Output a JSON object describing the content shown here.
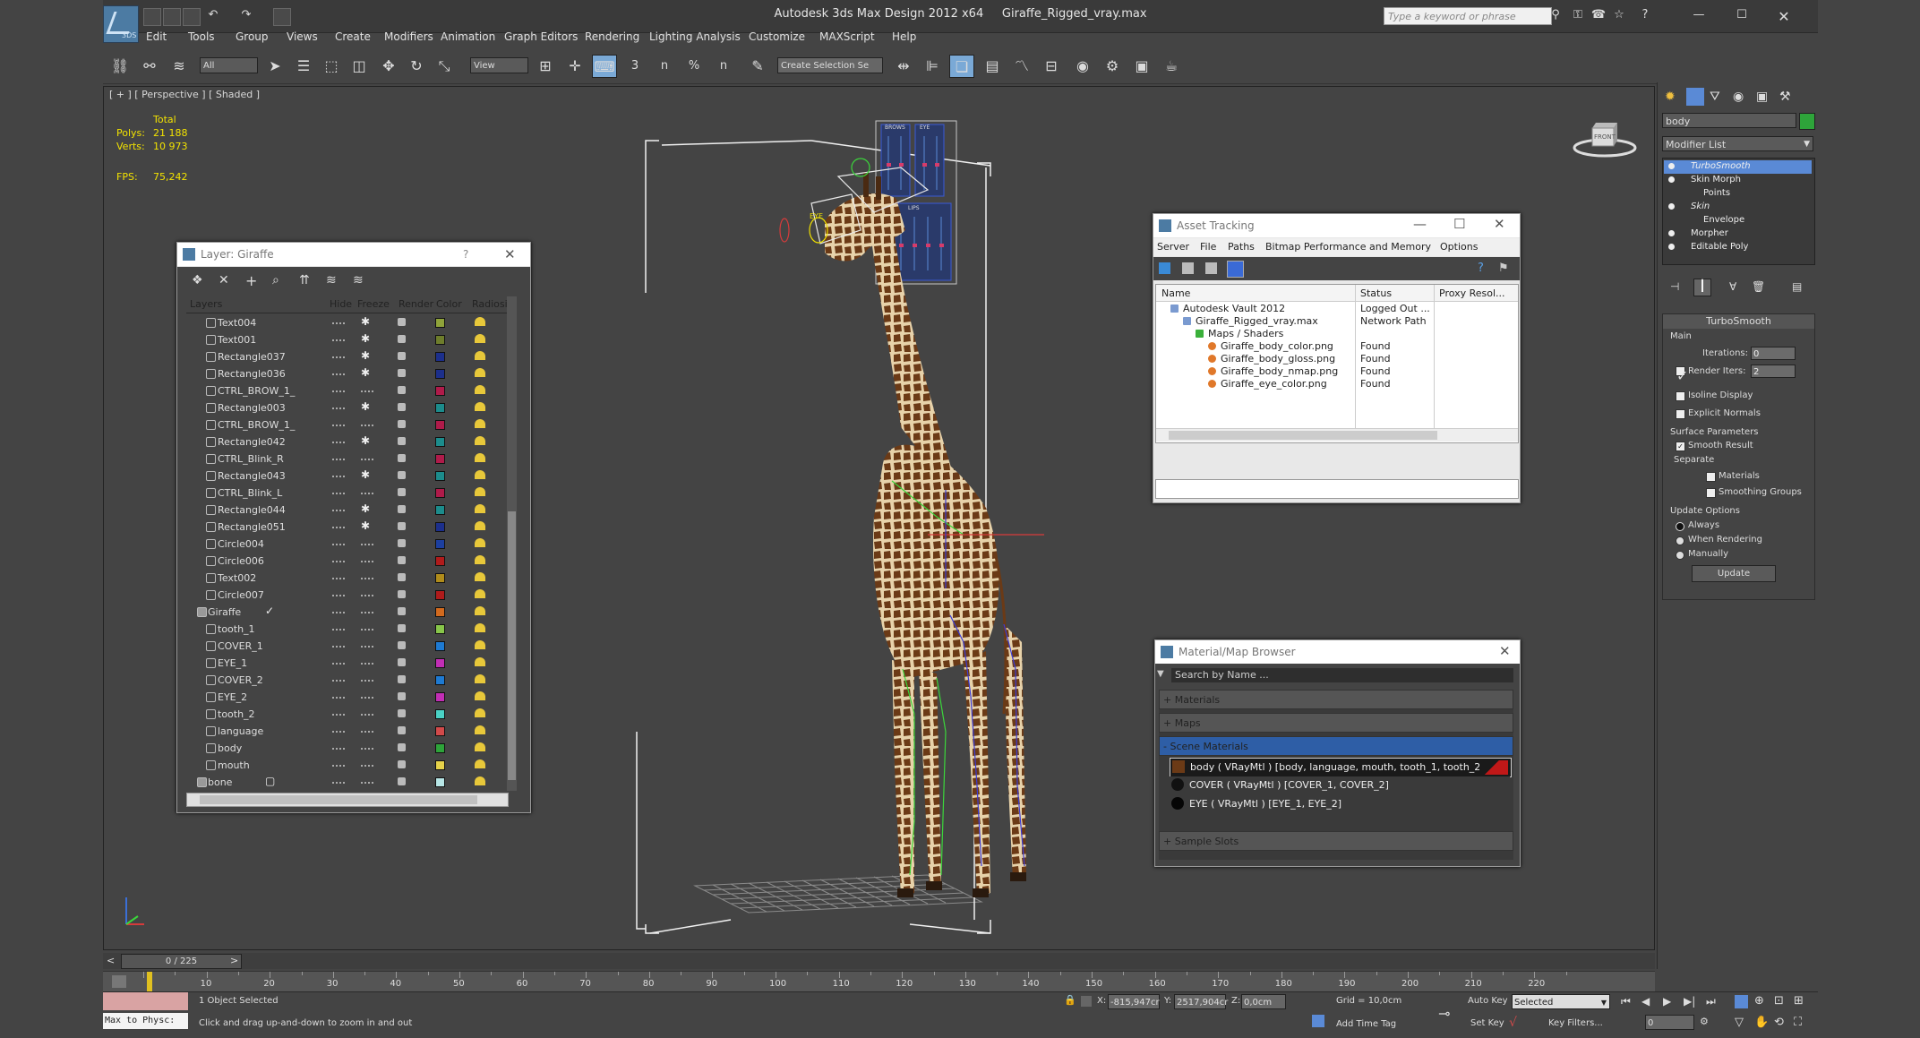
{
  "window": {
    "app_title": "Autodesk 3ds Max Design 2012 x64",
    "file_name": "Giraffe_Rigged_vray.max",
    "search_placeholder": "Type a keyword or phrase",
    "logo_text": "3DS"
  },
  "menu": [
    "Edit",
    "Tools",
    "Group",
    "Views",
    "Create",
    "Modifiers",
    "Animation",
    "Graph Editors",
    "Rendering",
    "Lighting Analysis",
    "Customize",
    "MAXScript",
    "Help"
  ],
  "toolbar": {
    "selection_filter": "All",
    "ref_coord": "View",
    "selection_set": "Create Selection Se",
    "snap_labels": [
      "3",
      "n",
      "%",
      "n"
    ]
  },
  "viewport": {
    "label": "[ + ] [ Perspective ] [ Shaded ]",
    "stats_header": "Total",
    "polys_label": "Polys:",
    "polys_value": "21 188",
    "verts_label": "Verts:",
    "verts_value": "10 973",
    "fps_label": "FPS:",
    "fps_value": "75,242",
    "viewcube_label": "FRONT",
    "rig_labels": {
      "brows": "BROWS",
      "eye": "EYE",
      "lips": "LIPS",
      "eye_ctrl": "EYE"
    }
  },
  "layer_panel": {
    "title": "Layer: Giraffe",
    "help": "?",
    "columns": [
      "Layers",
      "Hide",
      "Freeze",
      "Render",
      "Color",
      "Radiosi"
    ],
    "rows": [
      {
        "name": "Text004",
        "color": "#8fa33a",
        "freeze": true,
        "type": "item"
      },
      {
        "name": "Text001",
        "color": "#6e7d2c",
        "freeze": true,
        "type": "item"
      },
      {
        "name": "Rectangle037",
        "color": "#1c2f8c",
        "freeze": true,
        "type": "item"
      },
      {
        "name": "Rectangle036",
        "color": "#1c2f8c",
        "freeze": true,
        "type": "item"
      },
      {
        "name": "CTRL_BROW_1_",
        "color": "#b01b4a",
        "freeze": false,
        "type": "item"
      },
      {
        "name": "Rectangle003",
        "color": "#1c8c8c",
        "freeze": true,
        "type": "item"
      },
      {
        "name": "CTRL_BROW_1_",
        "color": "#b01b4a",
        "freeze": false,
        "type": "item"
      },
      {
        "name": "Rectangle042",
        "color": "#1c8c8c",
        "freeze": true,
        "type": "item"
      },
      {
        "name": "CTRL_Blink_R",
        "color": "#b01b4a",
        "freeze": false,
        "type": "item"
      },
      {
        "name": "Rectangle043",
        "color": "#1c8c8c",
        "freeze": true,
        "type": "item"
      },
      {
        "name": "CTRL_Blink_L",
        "color": "#b01b4a",
        "freeze": false,
        "type": "item"
      },
      {
        "name": "Rectangle044",
        "color": "#1c8c8c",
        "freeze": true,
        "type": "item"
      },
      {
        "name": "Rectangle051",
        "color": "#1c2f8c",
        "freeze": true,
        "type": "item"
      },
      {
        "name": "Circle004",
        "color": "#1c3fa0",
        "freeze": false,
        "type": "item"
      },
      {
        "name": "Circle006",
        "color": "#b01b1b",
        "freeze": false,
        "type": "item"
      },
      {
        "name": "Text002",
        "color": "#b08c1b",
        "freeze": false,
        "type": "item"
      },
      {
        "name": "Circle007",
        "color": "#b01b1b",
        "freeze": false,
        "type": "item"
      },
      {
        "name": "Giraffe",
        "color": "#d26a1e",
        "freeze": false,
        "type": "layer",
        "current": true
      },
      {
        "name": "tooth_1",
        "color": "#88c64a",
        "freeze": false,
        "type": "item"
      },
      {
        "name": "COVER_1",
        "color": "#1e7ad2",
        "freeze": false,
        "type": "item"
      },
      {
        "name": "EYE_1",
        "color": "#c22eb5",
        "freeze": false,
        "type": "item"
      },
      {
        "name": "COVER_2",
        "color": "#1e7ad2",
        "freeze": false,
        "type": "item"
      },
      {
        "name": "EYE_2",
        "color": "#c22eb5",
        "freeze": false,
        "type": "item"
      },
      {
        "name": "tooth_2",
        "color": "#4ad2c6",
        "freeze": false,
        "type": "item"
      },
      {
        "name": "language",
        "color": "#d24a4a",
        "freeze": false,
        "type": "item"
      },
      {
        "name": "body",
        "color": "#2ea43a",
        "freeze": false,
        "type": "item"
      },
      {
        "name": "mouth",
        "color": "#e6d24a",
        "freeze": false,
        "type": "item"
      },
      {
        "name": "bone",
        "color": "#b7e6e6",
        "freeze": false,
        "type": "layer",
        "current": false
      }
    ]
  },
  "asset_tracking": {
    "title": "Asset Tracking",
    "menu": [
      "Server",
      "File",
      "Paths",
      "Bitmap Performance and Memory",
      "Options"
    ],
    "columns": [
      "Name",
      "Status",
      "Proxy Resol..."
    ],
    "rows": [
      {
        "name": "Autodesk Vault 2012",
        "status": "Logged Out ...",
        "indent": 0
      },
      {
        "name": "Giraffe_Rigged_vray.max",
        "status": "Network Path",
        "indent": 1
      },
      {
        "name": "Maps / Shaders",
        "status": "",
        "indent": 2
      },
      {
        "name": "Giraffe_body_color.png",
        "status": "Found",
        "indent": 3
      },
      {
        "name": "Giraffe_body_gloss.png",
        "status": "Found",
        "indent": 3
      },
      {
        "name": "Giraffe_body_nmap.png",
        "status": "Found",
        "indent": 3
      },
      {
        "name": "Giraffe_eye_color.png",
        "status": "Found",
        "indent": 3
      }
    ]
  },
  "material_browser": {
    "title": "Material/Map Browser",
    "search_placeholder": "Search by Name ...",
    "groups": [
      "+ Materials",
      "+ Maps",
      "- Scene Materials",
      "+ Sample Slots"
    ],
    "scene_materials": [
      "body  ( VRayMtl ) [body, language, mouth, tooth_1, tooth_2]",
      "COVER  ( VRayMtl ) [COVER_1, COVER_2]",
      "EYE  ( VRayMtl ) [EYE_1, EYE_2]"
    ]
  },
  "command_panel": {
    "object_name": "body",
    "object_color": "#2ea43a",
    "modifier_list": "Modifier List",
    "stack": [
      {
        "label": "TurboSmooth",
        "selected": true,
        "italic": true
      },
      {
        "label": "Skin Morph",
        "selected": false,
        "italic": false
      },
      {
        "label": "Points",
        "selected": false,
        "italic": false,
        "sub": true
      },
      {
        "label": "Skin",
        "selected": false,
        "italic": true
      },
      {
        "label": "Envelope",
        "selected": false,
        "italic": false,
        "sub": true
      },
      {
        "label": "Morpher",
        "selected": false,
        "italic": false
      },
      {
        "label": "Editable Poly",
        "selected": false,
        "italic": false
      }
    ],
    "rollout_title": "TurboSmooth",
    "main_label": "Main",
    "iterations_label": "Iterations:",
    "iterations_value": "0",
    "render_iters_label": "Render Iters:",
    "render_iters_value": "2",
    "isoline_label": "Isoline Display",
    "explicit_normals_label": "Explicit Normals",
    "surface_params_label": "Surface Parameters",
    "smooth_result_label": "Smooth Result",
    "separate_label": "Separate",
    "materials_label": "Materials",
    "smoothing_groups_label": "Smoothing Groups",
    "update_options_label": "Update Options",
    "always_label": "Always",
    "when_rendering_label": "When Rendering",
    "manually_label": "Manually",
    "update_button": "Update"
  },
  "timeline": {
    "frame_label": "0 / 225",
    "ticks": [
      "10",
      "20",
      "30",
      "40",
      "50",
      "60",
      "70",
      "80",
      "90",
      "100",
      "110",
      "120",
      "130",
      "140",
      "150",
      "160",
      "170",
      "180",
      "190",
      "200",
      "210",
      "220"
    ]
  },
  "status": {
    "maxscript_label": "Max to Physc:",
    "selection": "1 Object Selected",
    "prompt": "Click and drag up-and-down to zoom in and out",
    "x_label": "X:",
    "x_value": "-815,947cr",
    "y_label": "Y:",
    "y_value": "2517,904cr",
    "z_label": "Z:",
    "z_value": "0,0cm",
    "grid": "Grid = 10,0cm",
    "add_time_tag": "Add Time Tag",
    "auto_key": "Auto Key",
    "auto_key_mode": "Selected",
    "set_key": "Set Key",
    "key_filters": "Key Filters...",
    "frame_value": "0"
  }
}
